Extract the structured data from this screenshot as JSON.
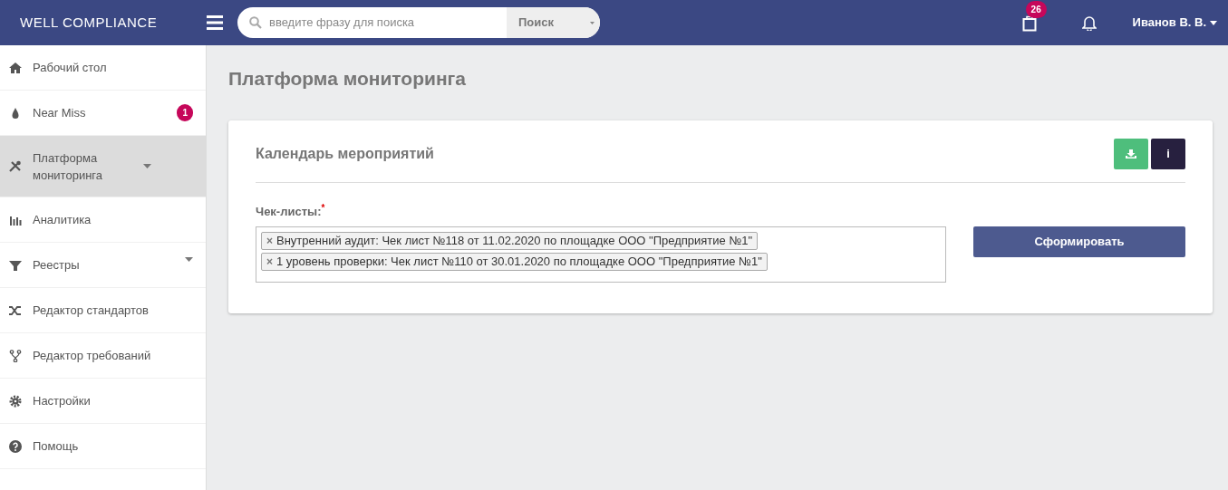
{
  "brand": "WELL COMPLIANCE",
  "search": {
    "placeholder": "введите фразу для поиска",
    "scope": "Поиск"
  },
  "notifications": {
    "count": "26"
  },
  "user": {
    "name": "Иванов В. В."
  },
  "sidebar": {
    "items": [
      {
        "label": "Рабочий стол",
        "kind": "home",
        "selected": false,
        "has_caret": false
      },
      {
        "label": "Near Miss",
        "kind": "drop",
        "selected": false,
        "has_caret": false,
        "badge": "1"
      },
      {
        "label": "Платформа мониторинга",
        "kind": "tools",
        "selected": true,
        "has_caret": true
      },
      {
        "label": "Аналитика",
        "kind": "bars",
        "selected": false,
        "has_caret": false
      },
      {
        "label": "Реестры",
        "kind": "funnel",
        "selected": false,
        "has_caret": true
      },
      {
        "label": "Редактор стандартов",
        "kind": "shuffle",
        "selected": false,
        "has_caret": false
      },
      {
        "label": "Редактор требований",
        "kind": "fork",
        "selected": false,
        "has_caret": false
      },
      {
        "label": "Настройки",
        "kind": "gear",
        "selected": false,
        "has_caret": false
      },
      {
        "label": "Помощь",
        "kind": "help",
        "selected": false,
        "has_caret": false
      }
    ]
  },
  "page_title": "Платформа мониторинга",
  "card": {
    "title": "Календарь мероприятий",
    "info_button": "i",
    "field": {
      "label": "Чек-листы:",
      "required_mark": "*",
      "tags": [
        {
          "remove": "×",
          "text": "Внутренний аудит: Чек лист №118 от 11.02.2020 по площадке ООО \"Предприятие №1\""
        },
        {
          "remove": "×",
          "text": "1 уровень проверки: Чек лист №110 от 30.01.2020 по площадке ООО \"Предприятие №1\""
        }
      ]
    },
    "submit_button": "Сформировать"
  }
}
